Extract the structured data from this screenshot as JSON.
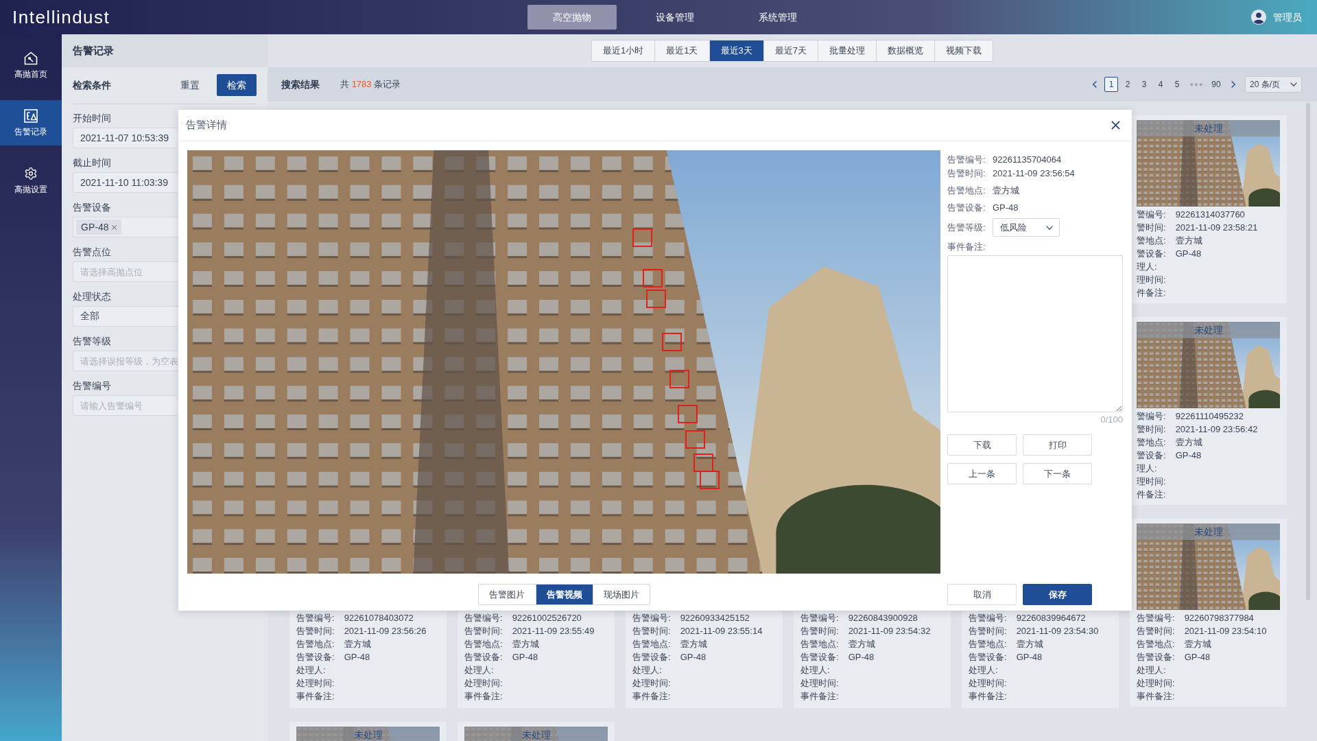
{
  "top_bar": {
    "logo": "Intellindust",
    "nav": [
      {
        "label": "高空抛物",
        "selected": true
      },
      {
        "label": "设备管理",
        "selected": false
      },
      {
        "label": "系统管理",
        "selected": false
      }
    ],
    "user": "管理员"
  },
  "sidebar": {
    "items": [
      {
        "label": "高抛首页",
        "selected": false
      },
      {
        "label": "告警记录",
        "selected": true
      },
      {
        "label": "高抛设置",
        "selected": false
      }
    ]
  },
  "filter_panel": {
    "title": "告警记录",
    "heading": "检索条件",
    "reset": "重置",
    "search": "检索",
    "fields": [
      {
        "label": "开始时间",
        "kind": "input",
        "value": "2021-11-07 10:53:39"
      },
      {
        "label": "截止时间",
        "kind": "input",
        "value": "2021-11-10 11:03:39"
      },
      {
        "label": "告警设备",
        "kind": "tags",
        "tags": [
          "GP-48"
        ]
      },
      {
        "label": "告警点位",
        "kind": "input",
        "placeholder": "请选择高抛点位"
      },
      {
        "label": "处理状态",
        "kind": "input",
        "value": "全部"
      },
      {
        "label": "告警等级",
        "kind": "input",
        "placeholder": "请选择误报等级，为空表"
      },
      {
        "label": "告警编号",
        "kind": "input",
        "placeholder": "请输入告警编号"
      }
    ]
  },
  "toolbar": {
    "filters": [
      {
        "label": "最近1小时",
        "selected": false
      },
      {
        "label": "最近1天",
        "selected": false
      },
      {
        "label": "最近3天",
        "selected": true
      },
      {
        "label": "最近7天",
        "selected": false
      },
      {
        "label": "批量处理",
        "selected": false
      },
      {
        "label": "数据概览",
        "selected": false
      },
      {
        "label": "视频下载",
        "selected": false
      }
    ]
  },
  "results": {
    "title": "搜索结果",
    "count_prefix": "共",
    "count": "1783",
    "count_suffix": "条记录",
    "pagination": {
      "pages": [
        {
          "label": "1",
          "selected": true
        },
        {
          "label": "2",
          "selected": false
        },
        {
          "label": "3",
          "selected": false
        },
        {
          "label": "4",
          "selected": false
        },
        {
          "label": "5",
          "selected": false
        }
      ],
      "last_page": {
        "label": "90",
        "selected": false
      },
      "page_size": "20 条/页"
    },
    "cards_beside_dialog": [
      {
        "status": "未处理",
        "fields": [
          {
            "label": "警编号:",
            "value": "92261314037760"
          },
          {
            "label": "警时间:",
            "value": "2021-11-09 23:58:21"
          },
          {
            "label": "警地点:",
            "value": "壹方城"
          },
          {
            "label": "警设备:",
            "value": "GP-48"
          },
          {
            "label": "理人:"
          },
          {
            "label": "理时间:"
          },
          {
            "label": "件备注:"
          }
        ]
      },
      {
        "status": "未处理",
        "fields": [
          {
            "label": "警编号:",
            "value": "92261110495232"
          },
          {
            "label": "警时间:",
            "value": "2021-11-09 23:56:42"
          },
          {
            "label": "警地点:",
            "value": "壹方城"
          },
          {
            "label": "警设备:",
            "value": "GP-48"
          },
          {
            "label": "理人:"
          },
          {
            "label": "理时间:"
          },
          {
            "label": "件备注:"
          }
        ]
      }
    ],
    "cards_below_dialog": [
      {
        "fields": [
          {
            "label": "告警编号:",
            "value": "92261078403072"
          },
          {
            "label": "告警时间:",
            "value": "2021-11-09 23:56:26"
          },
          {
            "label": "告警地点:",
            "value": "壹方城"
          },
          {
            "label": "告警设备:",
            "value": "GP-48"
          },
          {
            "label": "处理人:"
          },
          {
            "label": "处理时间:"
          },
          {
            "label": "事件备注:"
          }
        ]
      },
      {
        "fields": [
          {
            "label": "告警编号:",
            "value": "92261002526720"
          },
          {
            "label": "告警时间:",
            "value": "2021-11-09 23:55:49"
          },
          {
            "label": "告警地点:",
            "value": "壹方城"
          },
          {
            "label": "告警设备:",
            "value": "GP-48"
          },
          {
            "label": "处理人:"
          },
          {
            "label": "处理时间:"
          },
          {
            "label": "事件备注:"
          }
        ]
      },
      {
        "fields": [
          {
            "label": "告警编号:",
            "value": "92260933425152"
          },
          {
            "label": "告警时间:",
            "value": "2021-11-09 23:55:14"
          },
          {
            "label": "告警地点:",
            "value": "壹方城"
          },
          {
            "label": "告警设备:",
            "value": "GP-48"
          },
          {
            "label": "处理人:"
          },
          {
            "label": "处理时间:"
          },
          {
            "label": "事件备注:"
          }
        ]
      },
      {
        "fields": [
          {
            "label": "告警编号:",
            "value": "92260843900928"
          },
          {
            "label": "告警时间:",
            "value": "2021-11-09 23:54:32"
          },
          {
            "label": "告警地点:",
            "value": "壹方城"
          },
          {
            "label": "告警设备:",
            "value": "GP-48"
          },
          {
            "label": "处理人:"
          },
          {
            "label": "处理时间:"
          },
          {
            "label": "事件备注:"
          }
        ]
      },
      {
        "fields": [
          {
            "label": "告警编号:",
            "value": "92260839964672"
          },
          {
            "label": "告警时间:",
            "value": "2021-11-09 23:54:30"
          },
          {
            "label": "告警地点:",
            "value": "壹方城"
          },
          {
            "label": "告警设备:",
            "value": "GP-48"
          },
          {
            "label": "处理人:"
          },
          {
            "label": "处理时间:"
          },
          {
            "label": "事件备注:"
          }
        ]
      },
      {
        "status": "未处理",
        "fields": [
          {
            "label": "告警编号:",
            "value": "92260798377984"
          },
          {
            "label": "告警时间:",
            "value": "2021-11-09 23:54:10"
          },
          {
            "label": "告警地点:",
            "value": "壹方城"
          },
          {
            "label": "告警设备:",
            "value": "GP-48"
          },
          {
            "label": "处理人:"
          },
          {
            "label": "处理时间:"
          },
          {
            "label": "事件备注:"
          }
        ]
      }
    ],
    "cards_last_row": [
      {
        "status": "未处理"
      },
      {
        "status": "未处理"
      }
    ]
  },
  "dialog": {
    "title": "告警详情",
    "info": [
      {
        "label": "告警编号:",
        "value": "92261135704064"
      },
      {
        "label": "告警时间:",
        "value": "2021-11-09 23:56:54"
      },
      {
        "label": "告警地点:",
        "value": "壹方城"
      },
      {
        "label": "告警设备:",
        "value": "GP-48"
      }
    ],
    "level": {
      "label": "告警等级:",
      "value": "低风险"
    },
    "remarks": {
      "label": "事件备注:",
      "counter": "0/100"
    },
    "actions": [
      "下载",
      "打印",
      "上一条",
      "下一条"
    ],
    "media_tabs": [
      {
        "label": "告警图片",
        "selected": false
      },
      {
        "label": "告警视频",
        "selected": true
      },
      {
        "label": "现场图片",
        "selected": false
      }
    ],
    "cancel": "取消",
    "save": "保存"
  }
}
